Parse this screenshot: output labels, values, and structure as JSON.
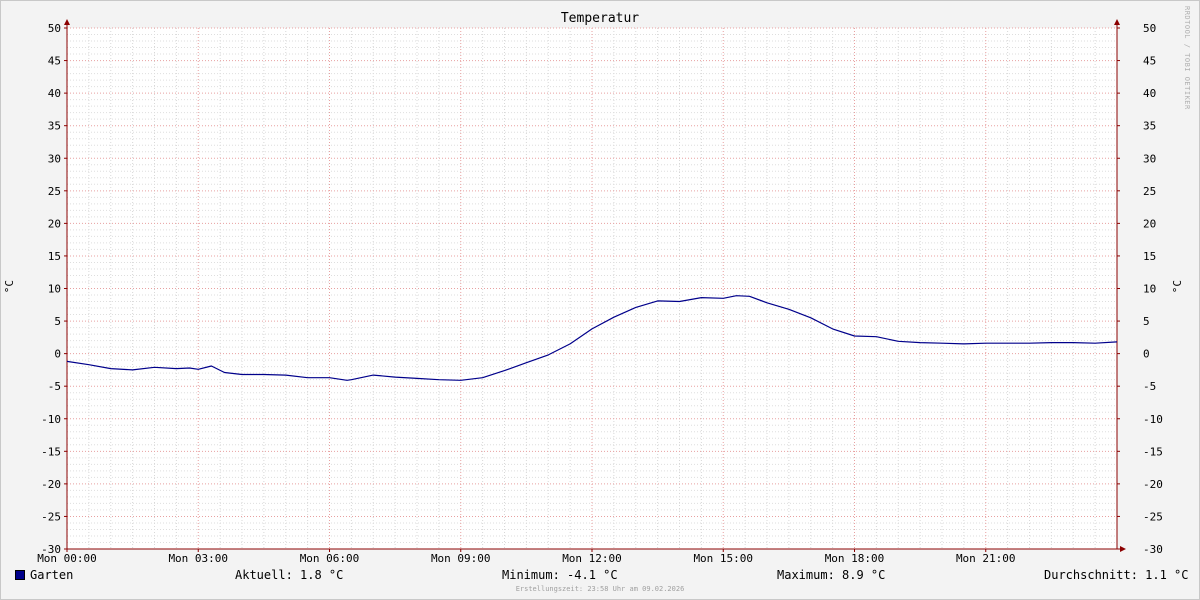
{
  "chart_data": {
    "type": "line",
    "title": "Temperatur",
    "ylabel": "°C",
    "ylim": [
      -30,
      50
    ],
    "yticks": [
      50,
      45,
      40,
      35,
      30,
      25,
      20,
      15,
      10,
      5,
      0,
      -5,
      -10,
      -15,
      -20,
      -25,
      -30
    ],
    "xlim": [
      0,
      24
    ],
    "xticks": [
      {
        "x": 0,
        "label": "Mon 00:00"
      },
      {
        "x": 3,
        "label": "Mon 03:00"
      },
      {
        "x": 6,
        "label": "Mon 06:00"
      },
      {
        "x": 9,
        "label": "Mon 09:00"
      },
      {
        "x": 12,
        "label": "Mon 12:00"
      },
      {
        "x": 15,
        "label": "Mon 15:00"
      },
      {
        "x": 18,
        "label": "Mon 18:00"
      },
      {
        "x": 21,
        "label": "Mon 21:00"
      }
    ],
    "grid": true,
    "series": [
      {
        "name": "Garten",
        "color": "#00008b",
        "x": [
          0,
          0.5,
          1,
          1.5,
          2,
          2.5,
          2.8,
          3,
          3.3,
          3.6,
          4,
          4.5,
          5,
          5.5,
          6,
          6.4,
          6.5,
          7,
          7.5,
          8,
          8.5,
          9,
          9.5,
          10,
          10.5,
          11,
          11.5,
          12,
          12.5,
          13,
          13.5,
          14,
          14.5,
          15,
          15.3,
          15.6,
          16,
          16.5,
          17,
          17.5,
          18,
          18.5,
          19,
          19.5,
          20,
          20.5,
          21,
          21.5,
          22,
          22.5,
          23,
          23.5,
          24
        ],
        "values": [
          -1.2,
          -1.7,
          -2.3,
          -2.5,
          -2.1,
          -2.3,
          -2.2,
          -2.4,
          -1.9,
          -2.9,
          -3.2,
          -3.2,
          -3.3,
          -3.7,
          -3.7,
          -4.1,
          -4.0,
          -3.3,
          -3.6,
          -3.8,
          -4.0,
          -4.1,
          -3.7,
          -2.6,
          -1.4,
          -0.2,
          1.5,
          3.8,
          5.6,
          7.1,
          8.1,
          8.0,
          8.6,
          8.5,
          8.9,
          8.8,
          7.8,
          6.8,
          5.5,
          3.8,
          2.7,
          2.6,
          1.9,
          1.7,
          1.6,
          1.5,
          1.6,
          1.6,
          1.6,
          1.7,
          1.7,
          1.6,
          1.8
        ]
      }
    ]
  },
  "legend": {
    "series_name": "Garten",
    "current": "Aktuell: 1.8 °C",
    "minimum": "Minimum: -4.1 °C",
    "maximum": "Maximum: 8.9 °C",
    "average": "Durchschnitt: 1.1 °C"
  },
  "watermark": "RRDTOOL / TOBI OETIKER",
  "footer": "Erstellungszeit: 23:58 Uhr am 09.02.2026"
}
